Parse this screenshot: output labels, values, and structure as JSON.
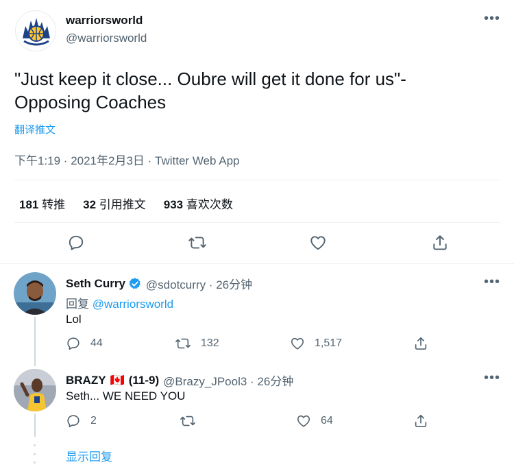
{
  "tweet": {
    "display_name": "warriorsworld",
    "handle": "@warriorsworld",
    "avatar_text": "WARRIORS WORLD",
    "text_line1": "\"Just keep it close... Oubre will get it done for us\"-",
    "text_line2": "Opposing Coaches",
    "translate": "翻译推文",
    "meta": "下午1:19 · 2021年2月3日 · Twitter Web App",
    "stats": [
      {
        "count": "181",
        "label": "转推"
      },
      {
        "count": "32",
        "label": "引用推文"
      },
      {
        "count": "933",
        "label": "喜欢次数"
      }
    ]
  },
  "replies": [
    {
      "display_name": "Seth Curry",
      "verified": true,
      "handle_time": "@sdotcurry · 26分钟",
      "reply_prefix": "回复",
      "reply_to": "@warriorsworld",
      "text": "Lol",
      "replies": "44",
      "retweets": "132",
      "likes": "1,517"
    },
    {
      "display_name": "BRAZY",
      "flag": "🇨🇦",
      "record": "(11-9)",
      "handle_time": "@Brazy_JPool3 · 26分钟",
      "text": "Seth... WE NEED YOU",
      "replies": "2",
      "retweets": "",
      "likes": "64"
    }
  ],
  "show_replies": "显示回复",
  "colors": {
    "accent": "#1d9bf0",
    "text": "#0f1419",
    "muted": "#536471",
    "divider": "#eff3f4"
  }
}
